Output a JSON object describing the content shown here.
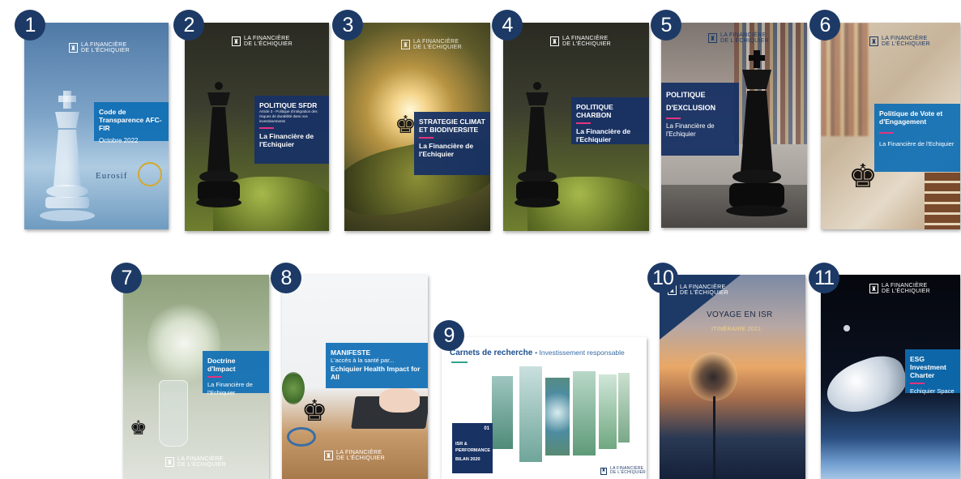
{
  "logo": {
    "line1": "LA FINANCIÈRE",
    "line2": "DE L'ÉCHIQUIER"
  },
  "colors": {
    "badge": "#1d3a66",
    "accent": "#e5337f",
    "box_blue": "#0e6eb4",
    "box_navy": "#183264"
  },
  "covers": [
    {
      "num": "1",
      "title": "Code de Transparence AFC-FIR",
      "subtitle": "Octobre 2022",
      "brand": "Eurosif"
    },
    {
      "num": "2",
      "title": "POLITIQUE SFDR",
      "desc": "Article 3 - Politique d'intégration des risques de durabilité dans nos investissements",
      "subtitle": "La Financière de l'Echiquier"
    },
    {
      "num": "3",
      "title": "STRATEGIE CLIMAT ET BIODIVERSITE",
      "subtitle": "La Financière de l'Echiquier"
    },
    {
      "num": "4",
      "title": "POLITIQUE CHARBON",
      "subtitle": "La Financière de l'Echiquier"
    },
    {
      "num": "5",
      "title": "POLITIQUE D'EXCLUSION",
      "subtitle": "La Financière de l'Echiquier"
    },
    {
      "num": "6",
      "title": "Politique de Vote et d'Engagement",
      "subtitle": "La Financière de l'Echiquier"
    },
    {
      "num": "7",
      "title": "Doctrine d'Impact",
      "subtitle": "La Financière de l'Echiquier"
    },
    {
      "num": "8",
      "title": "MANIFESTE",
      "desc": "L'accès à la santé par...",
      "subtitle": "Echiquier Health Impact for All"
    },
    {
      "num": "9",
      "title": "Carnets de recherche",
      "tag": "• Investissement responsable",
      "box_title": "ISR & PERFORMANCE",
      "box_sub": "BILAN 2020",
      "box_num": "01"
    },
    {
      "num": "10",
      "title": "VOYAGE EN ISR",
      "subtitle": "ITINÉRAIRE 2021"
    },
    {
      "num": "11",
      "title": "ESG Investment Charter",
      "subtitle": "Echiquier Space"
    }
  ]
}
